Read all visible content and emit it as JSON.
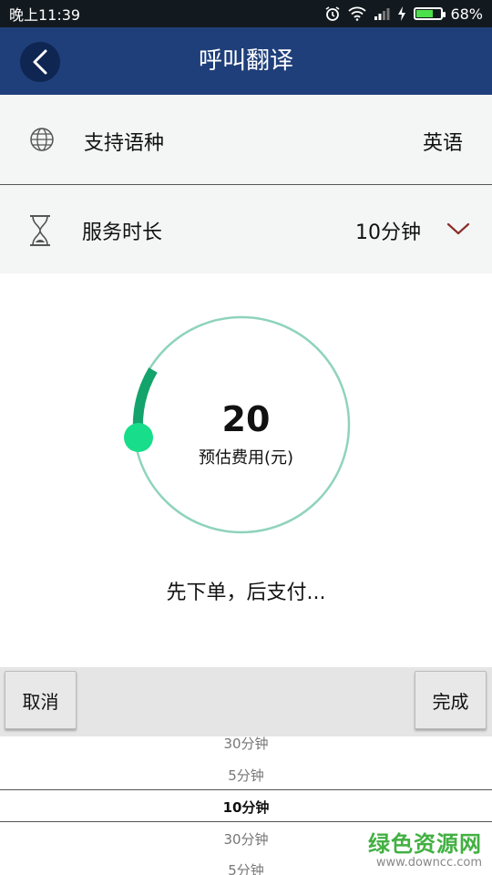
{
  "status_bar": {
    "time": "晚上11:39",
    "battery_percent": "68%",
    "battery_level": 0.68
  },
  "header": {
    "title": "呼叫翻译"
  },
  "language_row": {
    "label": "支持语种",
    "value": "英语"
  },
  "duration_row": {
    "label": "服务时长",
    "value": "10分钟"
  },
  "fee": {
    "amount": "20",
    "label": "预估费用(元)"
  },
  "note": "先下单，后支付...",
  "picker": {
    "cancel_label": "取消",
    "done_label": "完成",
    "options": [
      "30分钟",
      "5分钟",
      "10分钟",
      "30分钟",
      "5分钟"
    ],
    "selected_index": 2
  },
  "watermark": {
    "title": "绿色资源网",
    "url": "www.downcc.com"
  },
  "colors": {
    "header": "#1f3f7a",
    "ring": "#8fd3bd",
    "progress": "#14a36a",
    "knob": "#18dd8a",
    "chevron": "#8b2b2b"
  }
}
